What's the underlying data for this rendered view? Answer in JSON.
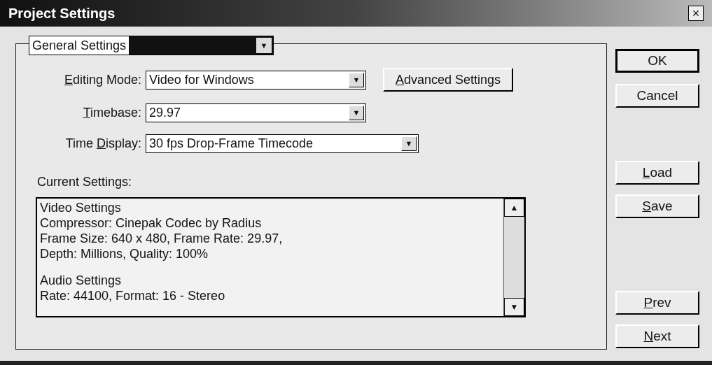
{
  "window": {
    "title": "Project Settings",
    "close": "×"
  },
  "section_dropdown": {
    "value": "General Settings",
    "arrow": "▼"
  },
  "fields": [
    {
      "label": {
        "key": "E",
        "after": "diting Mode:"
      },
      "value": "Video for Windows",
      "arrow": "▼",
      "kind": "wide"
    },
    {
      "label": {
        "key": "T",
        "after": "imebase:"
      },
      "value": "29.97",
      "arrow": "▼",
      "kind": "wide"
    },
    {
      "label": {
        "before": "Time ",
        "key": "D",
        "after": "isplay:"
      },
      "value": "30 fps Drop-Frame Timecode",
      "arrow": "▼",
      "kind": "wider"
    }
  ],
  "advanced_button": {
    "label": {
      "key": "A",
      "after": "dvanced Settings"
    }
  },
  "current_settings": {
    "label": "Current Settings:",
    "scroll_up": "▲",
    "scroll_down": "▼",
    "groups": [
      {
        "lines": [
          "Video Settings",
          "Compressor: Cinepak Codec by Radius",
          "Frame Size: 640 x 480, Frame Rate: 29.97,",
          "Depth: Millions, Quality: 100%"
        ]
      },
      {
        "lines": [
          "Audio Settings",
          "Rate: 44100, Format: 16 - Stereo"
        ]
      }
    ]
  },
  "buttons": [
    {
      "label": {
        "before": "OK"
      },
      "kind": "default"
    },
    {
      "label": {
        "before": "Cancel"
      },
      "kind": "normal"
    },
    {
      "label": {
        "key": "L",
        "after": "oad"
      },
      "kind": "normal"
    },
    {
      "label": {
        "key": "S",
        "after": "ave"
      },
      "kind": "normal"
    },
    {
      "label": {
        "key": "P",
        "after": "rev"
      },
      "kind": "normal"
    },
    {
      "label": {
        "key": "N",
        "after": "ext"
      },
      "kind": "normal"
    }
  ]
}
